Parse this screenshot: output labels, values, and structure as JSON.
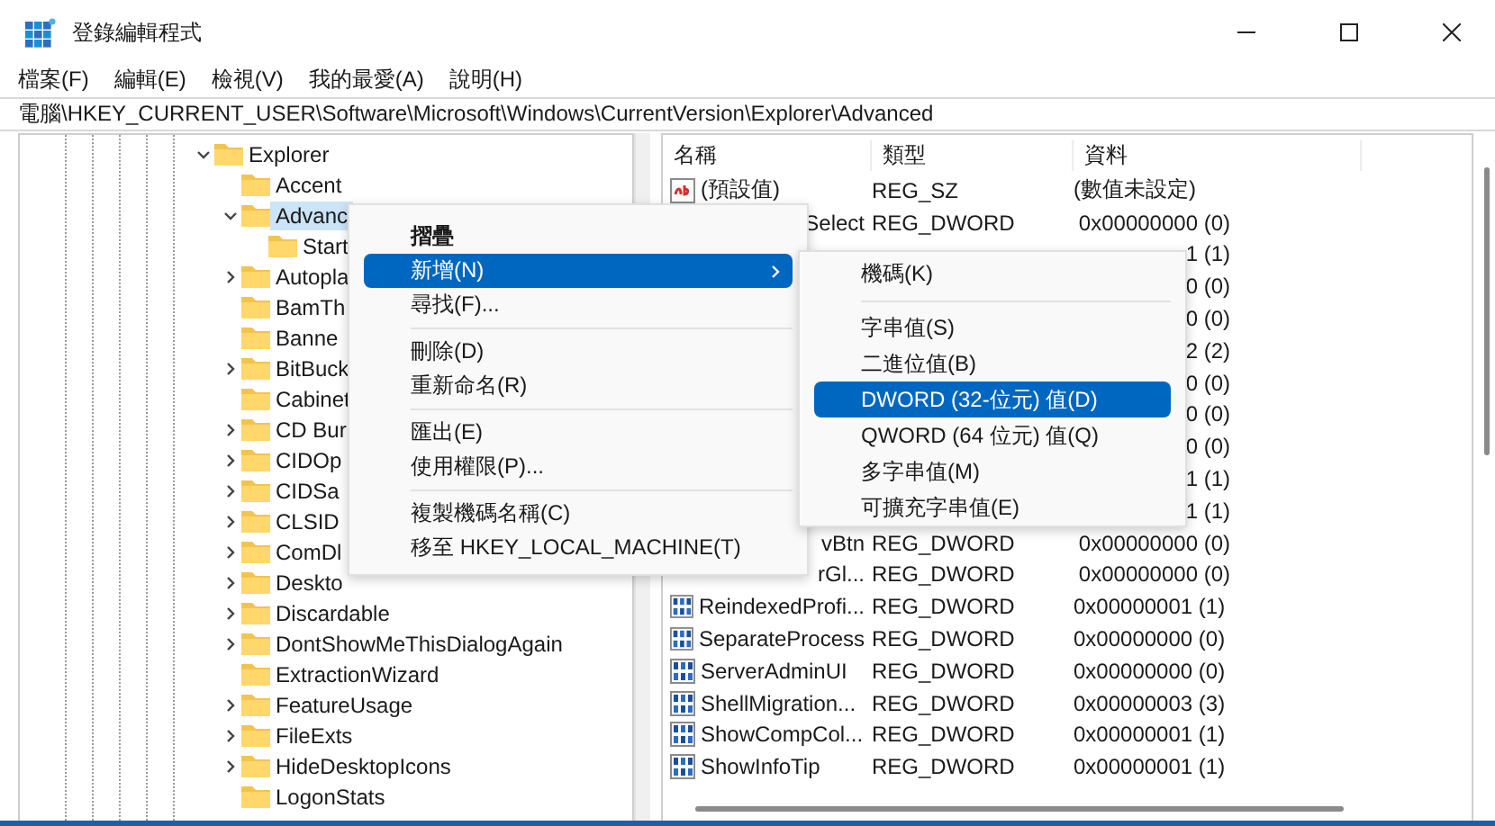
{
  "window": {
    "title": "登錄編輯程式"
  },
  "menu_bar": [
    "檔案(F)",
    "編輯(E)",
    "檢視(V)",
    "我的最愛(A)",
    "說明(H)"
  ],
  "address": "電腦\\HKEY_CURRENT_USER\\Software\\Microsoft\\Windows\\CurrentVersion\\Explorer\\Advanced",
  "tree": [
    {
      "label": "Explorer",
      "expanded": true,
      "selected": false,
      "children": [
        {
          "label": "Accent",
          "selected": false
        },
        {
          "label": "Advanc",
          "expanded": true,
          "selected": true,
          "children": [
            {
              "label": "Start",
              "selected": false
            }
          ]
        },
        {
          "label": "Autopla",
          "expanded": false,
          "selected": false
        },
        {
          "label": "BamTh",
          "selected": false
        },
        {
          "label": "Banne",
          "selected": false
        },
        {
          "label": "BitBuck",
          "expanded": false,
          "selected": false
        },
        {
          "label": "Cabinet",
          "selected": false
        },
        {
          "label": "CD Bur",
          "expanded": false,
          "selected": false
        },
        {
          "label": "CIDOp",
          "expanded": false,
          "selected": false
        },
        {
          "label": "CIDSa",
          "expanded": false,
          "selected": false
        },
        {
          "label": "CLSID",
          "expanded": false,
          "selected": false
        },
        {
          "label": "ComDl",
          "expanded": false,
          "selected": false
        },
        {
          "label": "Deskto",
          "expanded": false,
          "selected": false
        },
        {
          "label": "Discardable",
          "expanded": false,
          "selected": false
        },
        {
          "label": "DontShowMeThisDialogAgain",
          "expanded": false,
          "selected": false
        },
        {
          "label": "ExtractionWizard",
          "selected": false
        },
        {
          "label": "FeatureUsage",
          "expanded": false,
          "selected": false
        },
        {
          "label": "FileExts",
          "expanded": false,
          "selected": false
        },
        {
          "label": "HideDesktopIcons",
          "expanded": false,
          "selected": false
        },
        {
          "label": "LogonStats",
          "selected": false
        }
      ]
    }
  ],
  "values": {
    "columns": [
      "名稱",
      "類型",
      "資料"
    ],
    "rows": [
      {
        "kind": "string",
        "covered": false,
        "name": "(預設值)",
        "type": "REG_SZ",
        "data": "(數值未設定)"
      },
      {
        "covered": true,
        "name": "Select",
        "type": "REG_DWORD",
        "data": "0x00000000 (0)"
      },
      {
        "covered": true,
        "data": "1 (1)"
      },
      {
        "covered": true,
        "data": "0 (0)"
      },
      {
        "covered": true,
        "data": "0 (0)"
      },
      {
        "covered": true,
        "data": "2 (2)"
      },
      {
        "covered": true,
        "data": "0 (0)"
      },
      {
        "covered": true,
        "data": "0 (0)"
      },
      {
        "covered": true,
        "data": "0 (0)"
      },
      {
        "covered": true,
        "data": "1 (1)"
      },
      {
        "covered": true,
        "data": "1 (1)"
      },
      {
        "covered": true,
        "name": "vBtn",
        "type": "REG_DWORD",
        "data": "0x00000000 (0)"
      },
      {
        "covered": true,
        "name": "rGl...",
        "type": "REG_DWORD",
        "data": "0x00000000 (0)"
      },
      {
        "kind": "dword",
        "covered": false,
        "name": "ReindexedProfi...",
        "type": "REG_DWORD",
        "data": "0x00000001 (1)"
      },
      {
        "kind": "dword",
        "covered": false,
        "name": "SeparateProcess",
        "type": "REG_DWORD",
        "data": "0x00000000 (0)"
      },
      {
        "kind": "dword",
        "covered": false,
        "name": "ServerAdminUI",
        "type": "REG_DWORD",
        "data": "0x00000000 (0)"
      },
      {
        "kind": "dword",
        "covered": false,
        "name": "ShellMigration...",
        "type": "REG_DWORD",
        "data": "0x00000003 (3)"
      },
      {
        "kind": "dword",
        "covered": false,
        "name": "ShowCompCol...",
        "type": "REG_DWORD",
        "data": "0x00000001 (1)"
      },
      {
        "kind": "dword",
        "covered": false,
        "name": "ShowInfoTip",
        "type": "REG_DWORD",
        "data": "0x00000001 (1)"
      }
    ]
  },
  "context_menu": [
    {
      "kind": "item",
      "label": "摺疊",
      "bold": true,
      "selected": false,
      "submenu": false
    },
    {
      "kind": "item",
      "label": "新增(N)",
      "bold": false,
      "selected": true,
      "submenu": true
    },
    {
      "kind": "item",
      "label": "尋找(F)...",
      "bold": false,
      "selected": false,
      "submenu": false
    },
    {
      "kind": "separator"
    },
    {
      "kind": "item",
      "label": "刪除(D)",
      "bold": false,
      "selected": false,
      "submenu": false
    },
    {
      "kind": "item",
      "label": "重新命名(R)",
      "bold": false,
      "selected": false,
      "submenu": false
    },
    {
      "kind": "separator"
    },
    {
      "kind": "item",
      "label": "匯出(E)",
      "bold": false,
      "selected": false,
      "submenu": false
    },
    {
      "kind": "item",
      "label": "使用權限(P)...",
      "bold": false,
      "selected": false,
      "submenu": false
    },
    {
      "kind": "separator"
    },
    {
      "kind": "item",
      "label": "複製機碼名稱(C)",
      "bold": false,
      "selected": false,
      "submenu": false
    },
    {
      "kind": "item",
      "label": "移至 HKEY_LOCAL_MACHINE(T)",
      "bold": false,
      "selected": false,
      "submenu": false
    }
  ],
  "submenu": [
    {
      "kind": "item",
      "label": "機碼(K)",
      "bold": false,
      "selected": false,
      "submenu": false
    },
    {
      "kind": "separator"
    },
    {
      "kind": "item",
      "label": "字串值(S)",
      "bold": false,
      "selected": false,
      "submenu": false
    },
    {
      "kind": "item",
      "label": "二進位值(B)",
      "bold": false,
      "selected": false,
      "submenu": false
    },
    {
      "kind": "item",
      "label": "DWORD (32-位元) 值(D)",
      "bold": false,
      "selected": true,
      "submenu": false
    },
    {
      "kind": "item",
      "label": "QWORD (64 位元) 值(Q)",
      "bold": false,
      "selected": false,
      "submenu": false
    },
    {
      "kind": "item",
      "label": "多字串值(M)",
      "bold": false,
      "selected": false,
      "submenu": false
    },
    {
      "kind": "item",
      "label": "可擴充字串值(E)",
      "bold": false,
      "selected": false,
      "submenu": false
    }
  ]
}
